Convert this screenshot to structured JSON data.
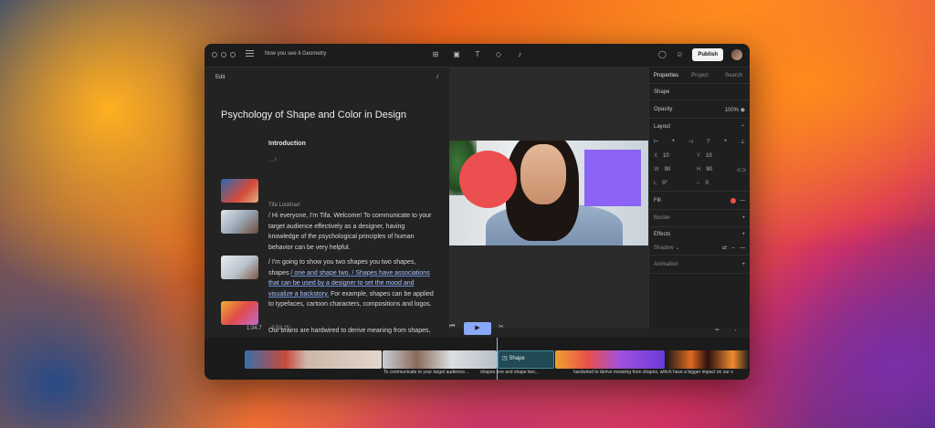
{
  "titlebar": {
    "doc_title": "Now you see it Geometry",
    "publish_label": "Publish"
  },
  "editor": {
    "edit_label": "Edit",
    "slash": "/",
    "heading": "Psychology of Shape and Color in Design",
    "intro": "Introduction",
    "ellipsis": "... /",
    "speaker": "Tifa Lockhart",
    "para1": "/ Hi everyone, I'm Tifa. Welcome! To communicate to your target audience effectively as a designer, having knowledge of the psychological principles of human behavior can be very helpful.",
    "para2_a": "/ I'm going to show you two shapes you two shapes, shapes ",
    "para2_hl": "/ one and shape two. / Shapes have associations that can be used by a designer to set the mood and visualize a backstory.",
    "para2_b": " For example, shapes can be applied to typefaces, cartoon characters, compositions and logos.",
    "para3": "Our brains are hardwired to derive meaning from shapes, which have a bigger impact on our",
    "timecode_current": "1:34.7",
    "timecode_total": "3:59.25"
  },
  "properties": {
    "tabs": [
      "Properties",
      "Project",
      "Search"
    ],
    "shape_label": "Shape",
    "opacity_label": "Opacity",
    "opacity_value": "100%",
    "layout_label": "Layout",
    "x_label": "X",
    "x_value": "10",
    "y_label": "Y",
    "y_value": "10",
    "w_label": "W",
    "w_value": "90",
    "h_label": "H",
    "h_value": "90",
    "r_label": "L",
    "r_value": "0°",
    "c_label": "⌐",
    "c_value": "0",
    "fill_label": "Fill",
    "border_label": "Border",
    "effects_label": "Effects",
    "shadow_label": "Shadow",
    "animation_label": "Animation",
    "fill_color": "#ec4f4f"
  },
  "timeline": {
    "shape_clip_label": "Shape",
    "caption1": "To communicate to your target audience...",
    "caption2": "shapes one and shape two...",
    "caption3": "hardwired to derive meaning from shapes, which have a bigger impact on our s"
  },
  "icons": {
    "menu": "menu-icon",
    "grid": "grid-icon",
    "image": "image-icon",
    "text": "text-icon",
    "shapes": "shapes-icon",
    "mic": "mic-icon",
    "comment": "comment-icon",
    "add_user": "add-user-icon",
    "eye": "eye-icon",
    "play": "play-icon",
    "skip_back": "skip-back-icon",
    "skip_forward": "skip-forward-icon"
  }
}
